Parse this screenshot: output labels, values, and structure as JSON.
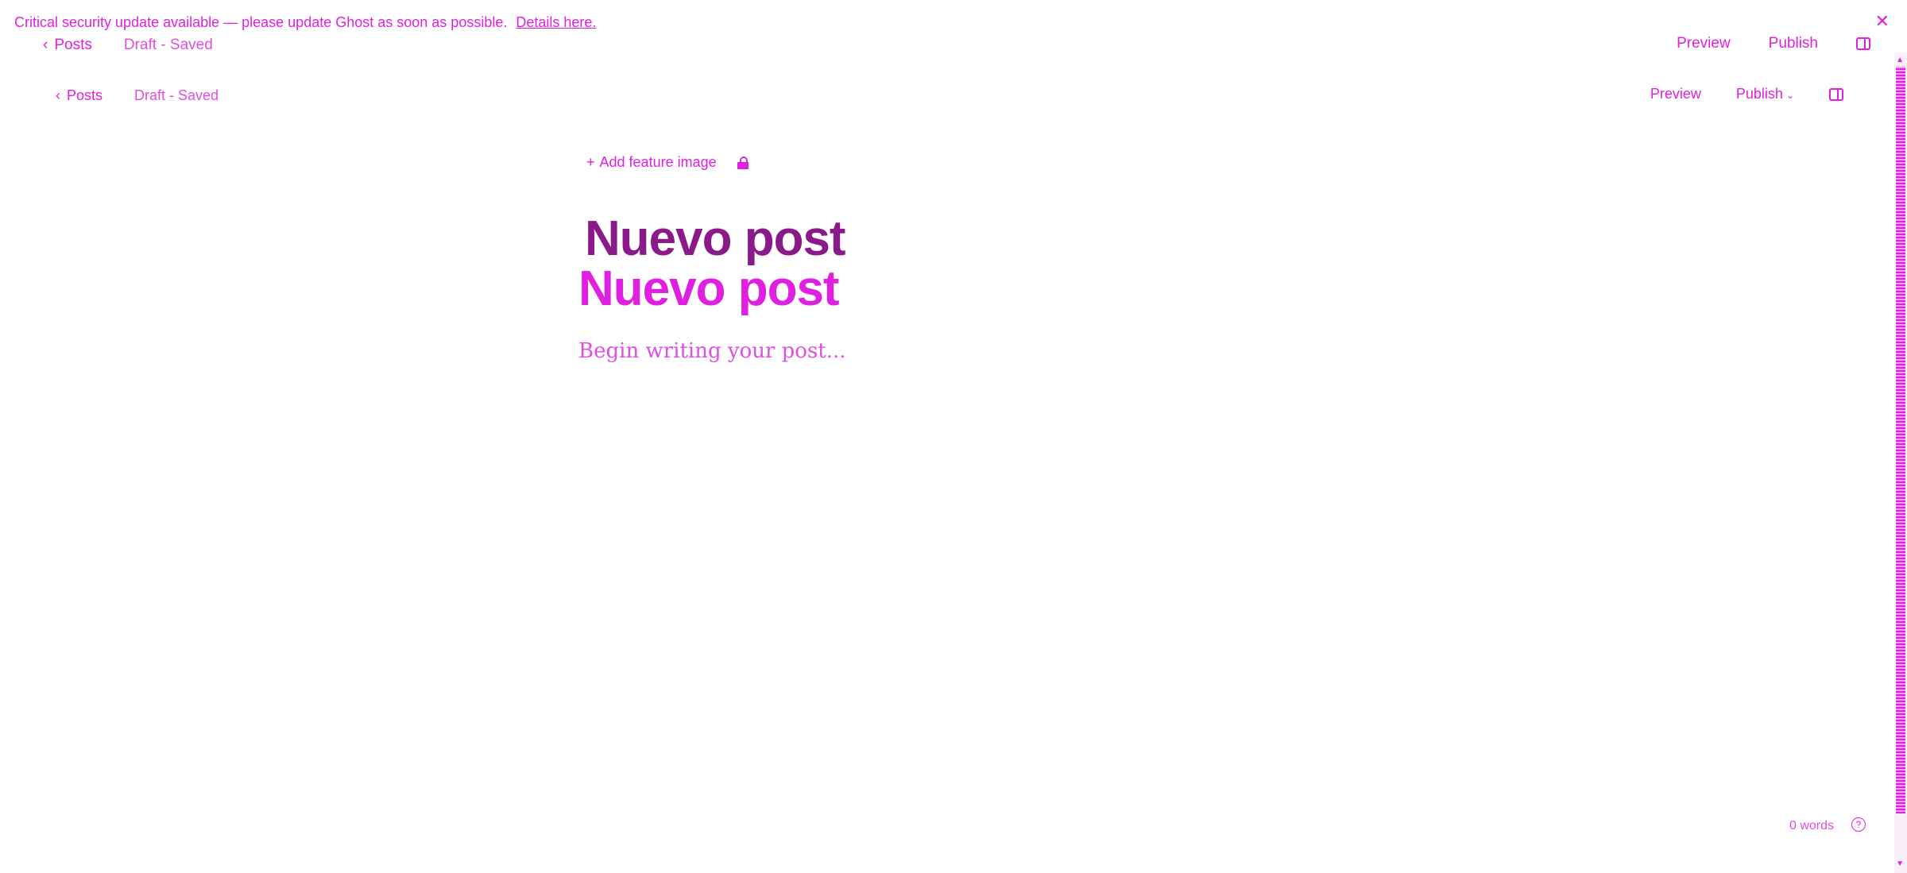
{
  "banner": {
    "message": "Critical security update available — please update Ghost as soon as possible.",
    "link_label": "Details here.",
    "close_icon": "close-icon"
  },
  "header_primary": {
    "back_label": "Posts",
    "status": "Draft - Saved",
    "preview_label": "Preview",
    "publish_label": "Publish"
  },
  "header_secondary": {
    "back_label": "Posts",
    "status": "Draft - Saved",
    "preview_label": "Preview",
    "publish_label": "Publish"
  },
  "editor": {
    "add_feature_image_label": "Add feature image",
    "title_dark": "Nuevo post",
    "title": "Nuevo post",
    "body_placeholder": "Begin writing your post..."
  },
  "footer": {
    "word_count": "0 words",
    "help_icon": "?"
  },
  "colors": {
    "accent": "#e020e0",
    "title_dark": "#8a1a8a",
    "background": "#ffffff"
  }
}
